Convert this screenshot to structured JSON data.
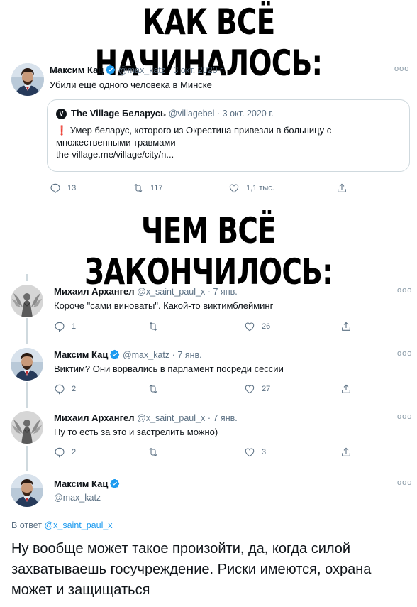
{
  "headlines": {
    "top": "КАК ВСЁ НАЧИНАЛОСЬ:",
    "middle": "ЧЕМ ВСЁ ЗАКОНЧИЛОСЬ:"
  },
  "tweet1": {
    "name": "Максим Кац",
    "handle": "@max_katz",
    "date": "· 3 окт. 2020 г.",
    "text": "Убили ещё одного человека в Минске",
    "more": "ooo",
    "quote": {
      "logo": "V",
      "name": "The Village Беларусь",
      "handle": "@villagebel",
      "date": "· 3 окт. 2020 г.",
      "line1": "❗ Умер беларус, которого из Окрестина привезли в больницу с",
      "line2": "множественными травмами",
      "line3": "the-village.me/village/city/n..."
    },
    "actions": {
      "replies": "13",
      "retweets": "117",
      "likes": "1,1 тыс."
    }
  },
  "tweet2": {
    "name": "Михаил Архангел",
    "handle": "@x_saint_paul_x",
    "date": "· 7 янв.",
    "text": "Короче \"сами виноваты\". Какой-то виктимблейминг",
    "more": "ooo",
    "actions": {
      "replies": "1",
      "retweets": "",
      "likes": "26"
    }
  },
  "tweet3": {
    "name": "Максим Кац",
    "handle": "@max_katz",
    "date": "· 7 янв.",
    "text": "Виктим? Они ворвались в парламент посреди сессии",
    "more": "ooo",
    "actions": {
      "replies": "2",
      "retweets": "",
      "likes": "27"
    }
  },
  "tweet4": {
    "name": "Михаил Архангел",
    "handle": "@x_saint_paul_x",
    "date": "· 7 янв.",
    "text": "Ну то есть за это и застрелить можно)",
    "more": "ooo",
    "actions": {
      "replies": "2",
      "retweets": "",
      "likes": "3"
    }
  },
  "tweet5": {
    "name": "Максим Кац",
    "handle": "@max_katz",
    "more": "ooo",
    "reply_prefix": "В ответ",
    "reply_handle": "@x_saint_paul_x",
    "text": "Ну вообще может такое произойти, да, когда силой захватываешь госучреждение. Риски имеются, охрана может и защищаться"
  },
  "colors": {
    "verified": "#1d9bf0",
    "muted": "#5b7083",
    "border": "#cfd9de",
    "alert": "#e0245e"
  }
}
